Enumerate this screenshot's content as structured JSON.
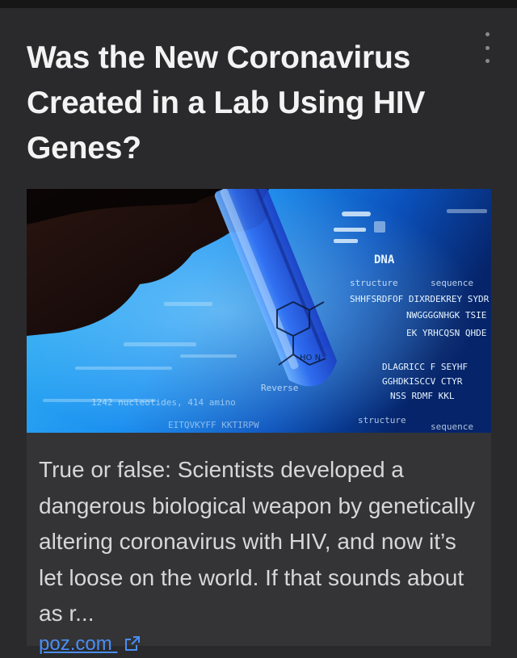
{
  "article": {
    "title": "Was the New Coronavirus Created in a Lab Using HIV Genes?",
    "description": "True or false: Scientists developed a dangerous biological weapon by genetically altering coronavirus with HIV, and now it’s let loose on the world. If that sounds about as r...",
    "source": "poz.com"
  },
  "icons": {
    "menu": "more-vertical-icon",
    "external": "external-link-icon"
  },
  "image": {
    "overlay_text": {
      "dna": "DNA",
      "structure": "structure",
      "sequence": "sequence",
      "nucleotides": "1242 nucleotides, 414 amino",
      "reverse": "Reverse",
      "seq_line_1": "SHHFSRDFOF DIXRDEKREY SYDR",
      "seq_line_2": "NWGGGGNHGK TSIE",
      "seq_line_3": "EK YRHCQSN QHDE",
      "seq_line_4": "DLAGRICC F SEYHF",
      "seq_line_5": "GGHDKISCCV CTYR",
      "seq_line_6": "NSS RDMF KKL",
      "seq_bottom": "EITQVKYFF KKTIRPW"
    }
  },
  "colors": {
    "background": "#2a2a2c",
    "title": "#f3f3f3",
    "description": "#d7d7d9",
    "link": "#4a8ef5",
    "image_blue": "#1f8fe6"
  }
}
